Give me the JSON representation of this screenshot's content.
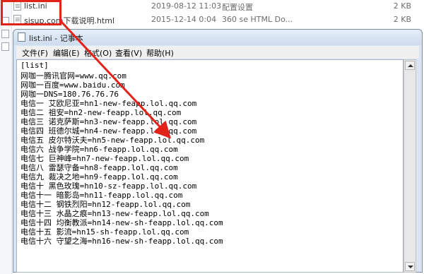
{
  "explorer": {
    "files": [
      {
        "name": "list.ini",
        "date": "2019-08-12 11:03",
        "type": "配置设置",
        "size": "2 KB"
      },
      {
        "name": "sisup.com下载说明.html",
        "date": "2015-12-14 0:04",
        "type": "360 se HTML Do...",
        "size": "2 KB"
      }
    ]
  },
  "notepad": {
    "title": "list.ini - 记事本",
    "menu": [
      "文件(F)",
      "编辑(E)",
      "格式(O)",
      "查看(V)",
      "帮助(H)"
    ],
    "lines": [
      "[list]",
      "网咖一腾讯官网=www.qq.com",
      "网咖一百度=www.baidu.com",
      "网咖一DNS=180.76.76.76",
      "电信一 艾欧尼亚=hn1-new-feapp.lol.qq.com",
      "电信二 祖安=hn2-new-feapp.lol.qq.com",
      "电信三 诺克萨斯=hn3-new-feapp.lol.qq.com",
      "电信四 班德尔城=hn4-new-feapp.lol.qq.com",
      "电信五 皮尔特沃夫=hn5-new-feapp.lol.qq.com",
      "电信六 战争学院=hn6-feapp.lol.qq.com",
      "电信七 巨神峰=hn7-new-feapp.lol.qq.com",
      "电信八 雷瑟守备=hn8-feapp.lol.qq.com",
      "电信九 裁决之地=hn9-feapp.lol.qq.com",
      "电信十 黑色玫瑰=hn10-sz-feapp.lol.qq.com",
      "电信十一 暗影岛=hn11-feapp.lol.qq.com",
      "电信十二 钢铁烈阳=hn12-feapp.lol.qq.com",
      "电信十三 水晶之痕=hn13-new-feapp.lol.qq.com",
      "电信十四 均衡教派=hn14-new-sh-feapp.lol.qq.com",
      "电信十五 影流=hn15-sh-feapp.lol.qq.com",
      "电信十六 守望之海=hn16-new-sh-feapp.lol.qq.com"
    ]
  },
  "colors": {
    "highlight": "#e2231a",
    "arrow": "#e2231a"
  },
  "icons": {
    "file": "file-icon",
    "notepad": "notepad-icon",
    "scroll_up": "scroll-up-arrow-icon",
    "scroll_down": "scroll-down-arrow-icon"
  }
}
